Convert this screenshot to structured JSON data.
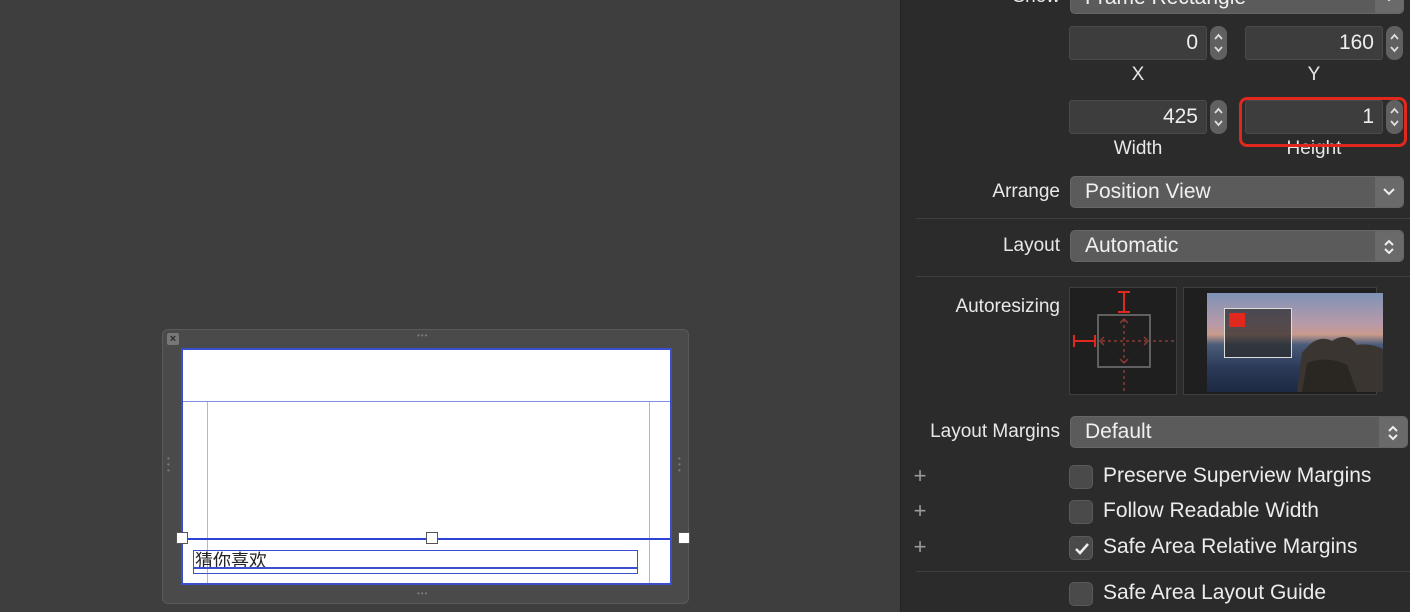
{
  "canvas": {
    "label_text": "猜你喜欢"
  },
  "inspector": {
    "show": {
      "label": "Show",
      "value": "Frame Rectangle"
    },
    "frame": {
      "x": {
        "value": "0",
        "label": "X"
      },
      "y": {
        "value": "160",
        "label": "Y"
      },
      "width": {
        "value": "425",
        "label": "Width"
      },
      "height": {
        "value": "1",
        "label": "Height"
      }
    },
    "arrange": {
      "label": "Arrange",
      "value": "Position View"
    },
    "layout": {
      "label": "Layout",
      "value": "Automatic"
    },
    "autoresizing": {
      "label": "Autoresizing"
    },
    "layout_margins": {
      "label": "Layout Margins",
      "value": "Default"
    },
    "checkboxes": [
      {
        "label": "Preserve Superview Margins",
        "checked": false
      },
      {
        "label": "Follow Readable Width",
        "checked": false
      },
      {
        "label": "Safe Area Relative Margins",
        "checked": true
      },
      {
        "label": "Safe Area Layout Guide",
        "checked": false
      }
    ],
    "colors": {
      "highlight": "#e0281f",
      "selection": "#3a4fd0",
      "panel_bg": "#2b2b2b",
      "canvas_bg": "#3e3e3e"
    }
  }
}
